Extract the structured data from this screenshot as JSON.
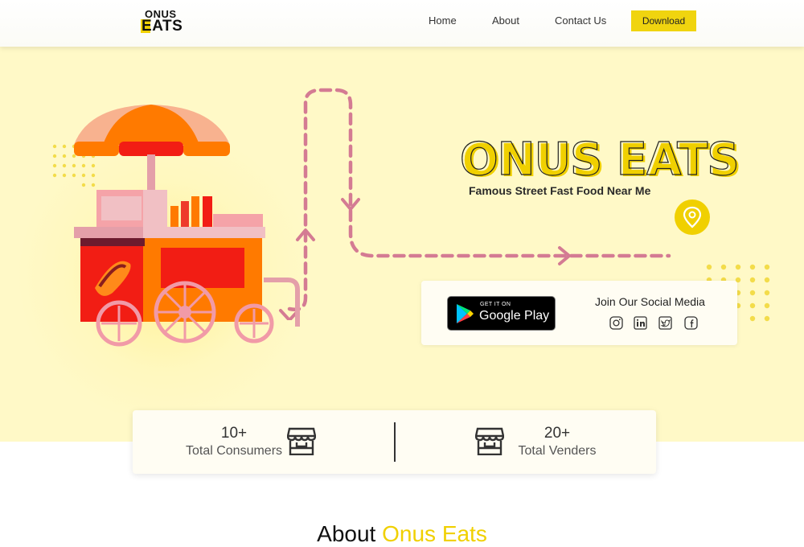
{
  "brand": {
    "logo_top": "ONUS",
    "logo_bottom_first": "E",
    "logo_bottom_rest": "ATS"
  },
  "nav": {
    "items": [
      {
        "label": "Home"
      },
      {
        "label": "About"
      },
      {
        "label": "Contact Us"
      }
    ],
    "download_label": "Download"
  },
  "hero": {
    "title": "ONUS EATS",
    "subtitle": "Famous Street Fast Food Near Me",
    "google_play_small": "GET IT ON",
    "google_play_big": "Google Play",
    "social_title": "Join Our Social Media",
    "social_icons": [
      "instagram-icon",
      "linkedin-icon",
      "twitter-icon",
      "facebook-icon"
    ]
  },
  "stats": [
    {
      "value": "10+",
      "label": "Total Consumers"
    },
    {
      "value": "20+",
      "label": "Total Venders"
    }
  ],
  "about": {
    "prefix": "About",
    "accent": "Onus Eats"
  },
  "colors": {
    "accent": "#f0d000",
    "hero_bg": "#fff9c7",
    "path": "#d47b93"
  }
}
